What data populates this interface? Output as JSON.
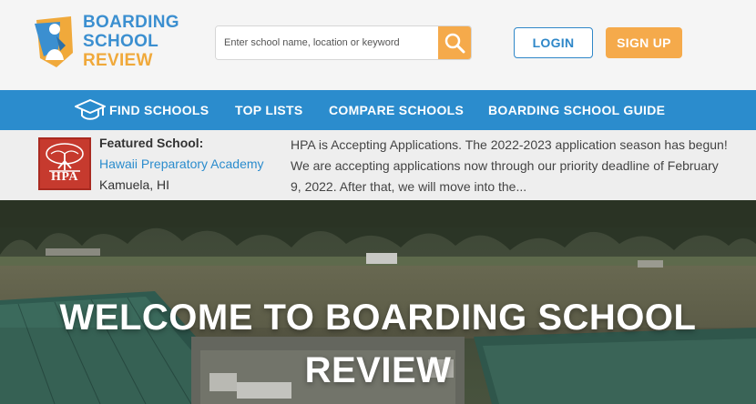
{
  "brand": {
    "line1": "BOARDING",
    "line2": "SCHOOL",
    "line3": "REVIEW",
    "primary_color": "#2b8ccd",
    "accent_color": "#f5aa4b"
  },
  "search": {
    "placeholder": "Enter school name, location or keyword",
    "button_icon": "search-icon"
  },
  "auth": {
    "login_label": "LOGIN",
    "signup_label": "SIGN UP"
  },
  "nav": {
    "items": [
      {
        "label": "FIND SCHOOLS",
        "icon": "graduation-cap-icon"
      },
      {
        "label": "TOP LISTS"
      },
      {
        "label": "COMPARE SCHOOLS"
      },
      {
        "label": "BOARDING SCHOOL GUIDE"
      }
    ]
  },
  "featured": {
    "label": "Featured School:",
    "school_name": "Hawaii Preparatory Academy",
    "location": "Kamuela, HI",
    "logo_text": "HPA",
    "description": "HPA is Accepting Applications. The 2022-2023 application season has begun!  We are accepting applications now through our priority deadline of February 9, 2022.  After that, we will move into the..."
  },
  "hero": {
    "title": "WELCOME TO BOARDING SCHOOL REVIEW"
  }
}
